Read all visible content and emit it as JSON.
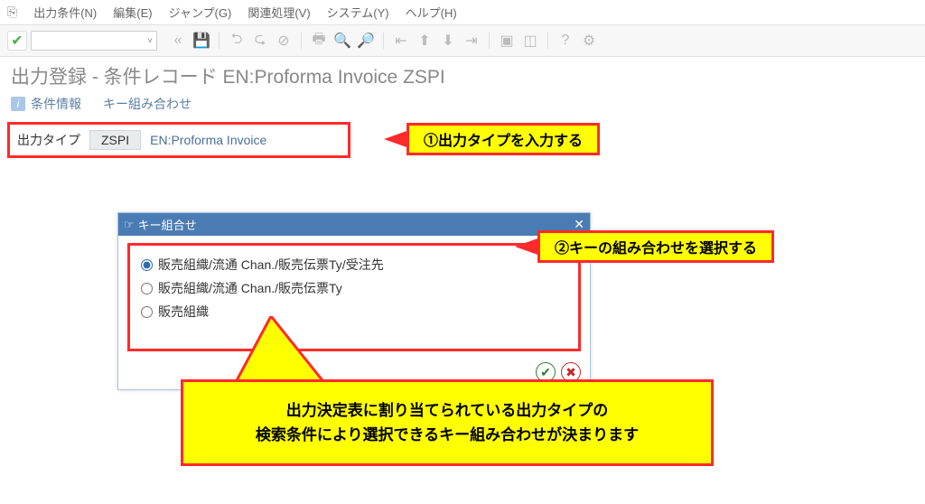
{
  "menubar": {
    "icon": "⎘",
    "items": [
      "出力条件(N)",
      "編集(E)",
      "ジャンプ(G)",
      "関連処理(V)",
      "システム(Y)",
      "ヘルプ(H)"
    ]
  },
  "page_title": "出力登録 - 条件レコード EN:Proforma Invoice ZSPI",
  "subbar": {
    "info_label": "条件情報",
    "key_label": "キー組み合わせ"
  },
  "output_type": {
    "label": "出力タイプ",
    "value": "ZSPI",
    "desc": "EN:Proforma Invoice"
  },
  "callout1": "①出力タイプを入力する",
  "dialog": {
    "title": "キー組合せ",
    "options": [
      "販売組織/流通 Chan./販売伝票Ty/受注先",
      "販売組織/流通 Chan./販売伝票Ty",
      "販売組織"
    ],
    "selected_index": 0
  },
  "callout2": "②キーの組み合わせを選択する",
  "big_callout_line1": "出力決定表に割り当てられている出力タイプの",
  "big_callout_line2": "検索条件により選択できるキー組み合わせが決まります"
}
